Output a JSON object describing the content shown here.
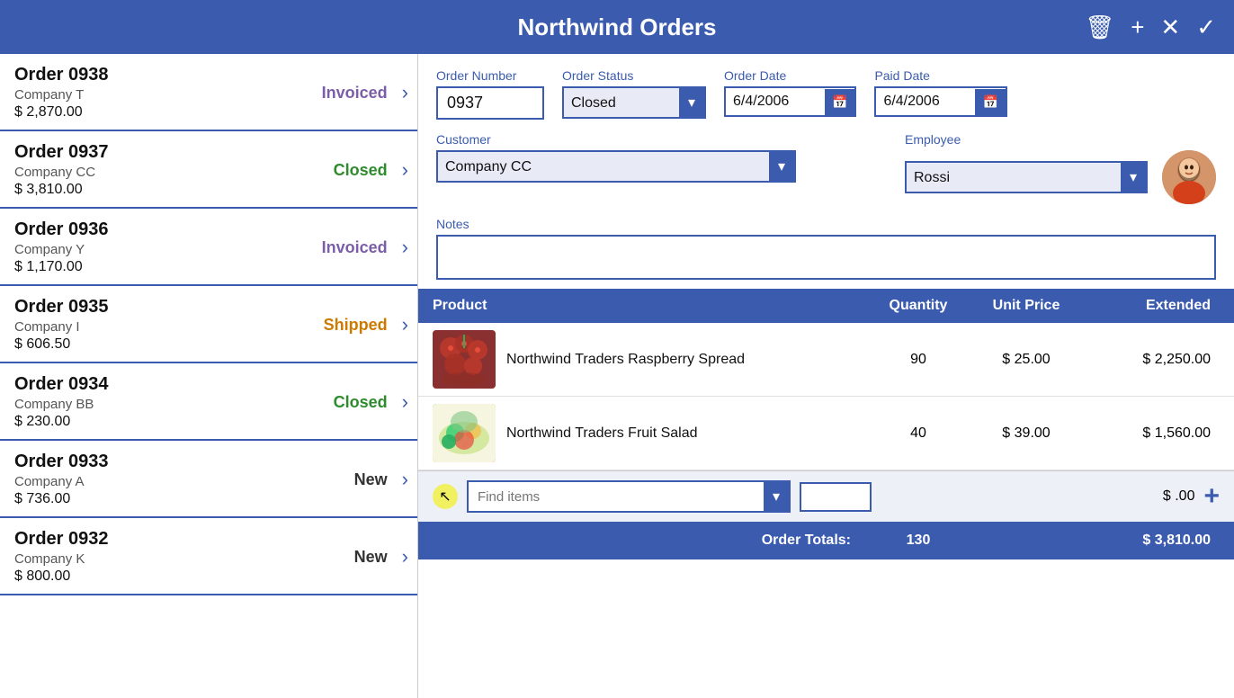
{
  "header": {
    "title": "Northwind Orders",
    "icons": {
      "delete": "🗑",
      "add": "+",
      "cancel": "✕",
      "confirm": "✓"
    }
  },
  "orders": [
    {
      "id": "Order 0938",
      "company": "Company T",
      "amount": "$ 2,870.00",
      "status": "Invoiced",
      "statusClass": "status-invoiced"
    },
    {
      "id": "Order 0937",
      "company": "Company CC",
      "amount": "$ 3,810.00",
      "status": "Closed",
      "statusClass": "status-closed"
    },
    {
      "id": "Order 0936",
      "company": "Company Y",
      "amount": "$ 1,170.00",
      "status": "Invoiced",
      "statusClass": "status-invoiced"
    },
    {
      "id": "Order 0935",
      "company": "Company I",
      "amount": "$ 606.50",
      "status": "Shipped",
      "statusClass": "status-shipped"
    },
    {
      "id": "Order 0934",
      "company": "Company BB",
      "amount": "$ 230.00",
      "status": "Closed",
      "statusClass": "status-closed"
    },
    {
      "id": "Order 0933",
      "company": "Company A",
      "amount": "$ 736.00",
      "status": "New",
      "statusClass": "status-new"
    },
    {
      "id": "Order 0932",
      "company": "Company K",
      "amount": "$ 800.00",
      "status": "New",
      "statusClass": "status-new"
    }
  ],
  "detail": {
    "order_number_label": "Order Number",
    "order_number_value": "0937",
    "order_status_label": "Order Status",
    "order_status_value": "Closed",
    "order_date_label": "Order Date",
    "order_date_value": "6/4/2006",
    "paid_date_label": "Paid Date",
    "paid_date_value": "6/4/2006",
    "customer_label": "Customer",
    "customer_value": "Company CC",
    "employee_label": "Employee",
    "employee_value": "Rossi",
    "notes_label": "Notes",
    "notes_value": ""
  },
  "table": {
    "col_product": "Product",
    "col_quantity": "Quantity",
    "col_unit_price": "Unit Price",
    "col_extended": "Extended"
  },
  "products": [
    {
      "name": "Northwind Traders Raspberry Spread",
      "quantity": "90",
      "unit_price": "$ 25.00",
      "extended": "$ 2,250.00",
      "img_type": "raspberry"
    },
    {
      "name": "Northwind Traders Fruit Salad",
      "quantity": "40",
      "unit_price": "$ 39.00",
      "extended": "$ 1,560.00",
      "img_type": "fruitsalad"
    }
  ],
  "add_item": {
    "find_placeholder": "Find items",
    "qty_placeholder": "",
    "price_display": "$ .00",
    "add_label": "+"
  },
  "totals": {
    "label": "Order Totals:",
    "total_qty": "130",
    "total_extended": "$ 3,810.00"
  }
}
